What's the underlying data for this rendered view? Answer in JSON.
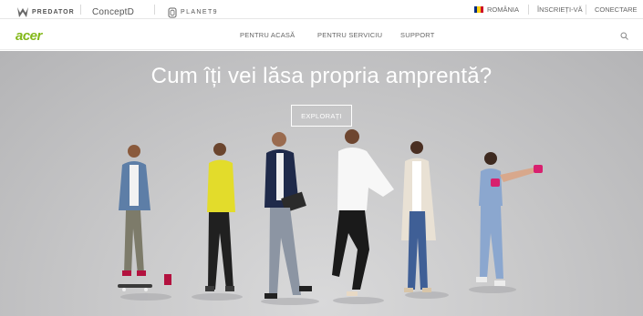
{
  "brands": {
    "predator": "PREDATOR",
    "concept": "ConceptD",
    "planet": "PLANET9"
  },
  "utility": {
    "country": "ROMÂNIA",
    "signup": "ÎNSCRIEȚI-VĂ",
    "login": "CONECTARE",
    "flag_colors": [
      "#002b7f",
      "#fcd116",
      "#ce1126"
    ]
  },
  "nav": {
    "logo": "acer",
    "logo_color": "#83b81a",
    "items": [
      "PENTRU ACASĂ",
      "PENTRU SERVICIU",
      "SUPPORT"
    ],
    "search_icon": "search-icon"
  },
  "hero": {
    "title": "Cum îți vei lăsa propria amprentă?",
    "cta": "EXPLORAȚI"
  }
}
